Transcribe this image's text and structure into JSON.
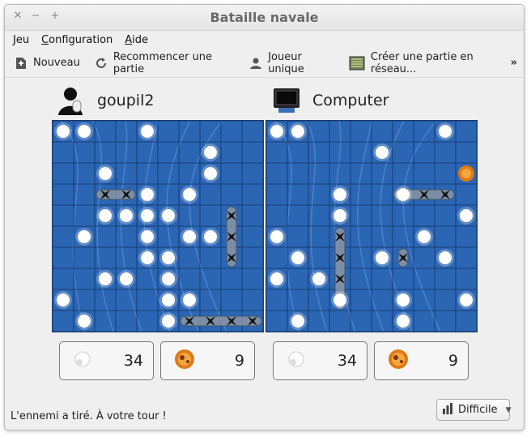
{
  "window": {
    "title": "Bataille navale"
  },
  "menu": [
    {
      "label": "Jeu",
      "mnemonic": "J",
      "rest": "eu"
    },
    {
      "label": "Configuration",
      "mnemonic": "C",
      "rest": "onfiguration"
    },
    {
      "label": "Aide",
      "mnemonic": "A",
      "rest": "ide"
    }
  ],
  "toolbar": {
    "new_label": "Nouveau",
    "restart_label": "Recommencer une partie",
    "single_label": "Joueur unique",
    "network_label": "Créer une partie en réseau...",
    "more_label": "»"
  },
  "players": [
    {
      "name": "goupil2",
      "misses": "34",
      "hits": "9"
    },
    {
      "name": "Computer",
      "misses": "34",
      "hits": "9"
    }
  ],
  "status": {
    "message": "L'ennemi a tiré. À votre tour !"
  },
  "difficulty": {
    "label": "Difficile"
  },
  "colors": {
    "water": "#2b66b5",
    "grid": "#0d1f3f"
  },
  "boards": {
    "left": {
      "misses": [
        [
          0,
          0
        ],
        [
          1,
          0
        ],
        [
          4,
          0
        ],
        [
          7,
          1
        ],
        [
          2,
          2
        ],
        [
          7,
          2
        ],
        [
          4,
          3
        ],
        [
          6,
          3
        ],
        [
          2,
          4
        ],
        [
          3,
          4
        ],
        [
          4,
          4
        ],
        [
          5,
          4
        ],
        [
          1,
          5
        ],
        [
          4,
          5
        ],
        [
          6,
          5
        ],
        [
          7,
          5
        ],
        [
          4,
          6
        ],
        [
          5,
          6
        ],
        [
          2,
          7
        ],
        [
          3,
          7
        ],
        [
          5,
          7
        ],
        [
          0,
          8
        ],
        [
          5,
          8
        ],
        [
          6,
          8
        ],
        [
          1,
          9
        ],
        [
          5,
          9
        ]
      ],
      "ships": [
        {
          "x": 2,
          "y": 3,
          "len": 2,
          "dir": "h",
          "hits": 2
        },
        {
          "x": 8,
          "y": 4,
          "len": 3,
          "dir": "v",
          "hits": 3
        },
        {
          "x": 6,
          "y": 9,
          "len": 4,
          "dir": "h",
          "hits": 4
        }
      ],
      "fire": []
    },
    "right": {
      "misses": [
        [
          0,
          0
        ],
        [
          1,
          0
        ],
        [
          8,
          0
        ],
        [
          5,
          1
        ],
        [
          3,
          3
        ],
        [
          6,
          3
        ],
        [
          3,
          4
        ],
        [
          9,
          4
        ],
        [
          0,
          5
        ],
        [
          7,
          5
        ],
        [
          1,
          6
        ],
        [
          5,
          6
        ],
        [
          8,
          6
        ],
        [
          0,
          7
        ],
        [
          2,
          7
        ],
        [
          3,
          8
        ],
        [
          6,
          8
        ],
        [
          1,
          9
        ],
        [
          6,
          9
        ],
        [
          9,
          8
        ]
      ],
      "ships": [
        {
          "x": 6,
          "y": 3,
          "len": 3,
          "dir": "h",
          "hits": 3
        },
        {
          "x": 3,
          "y": 5,
          "len": 4,
          "dir": "v",
          "hits": 4
        },
        {
          "x": 6,
          "y": 6,
          "len": 1,
          "dir": "v",
          "hits": 1
        }
      ],
      "fire": [
        [
          9,
          2
        ]
      ]
    }
  }
}
